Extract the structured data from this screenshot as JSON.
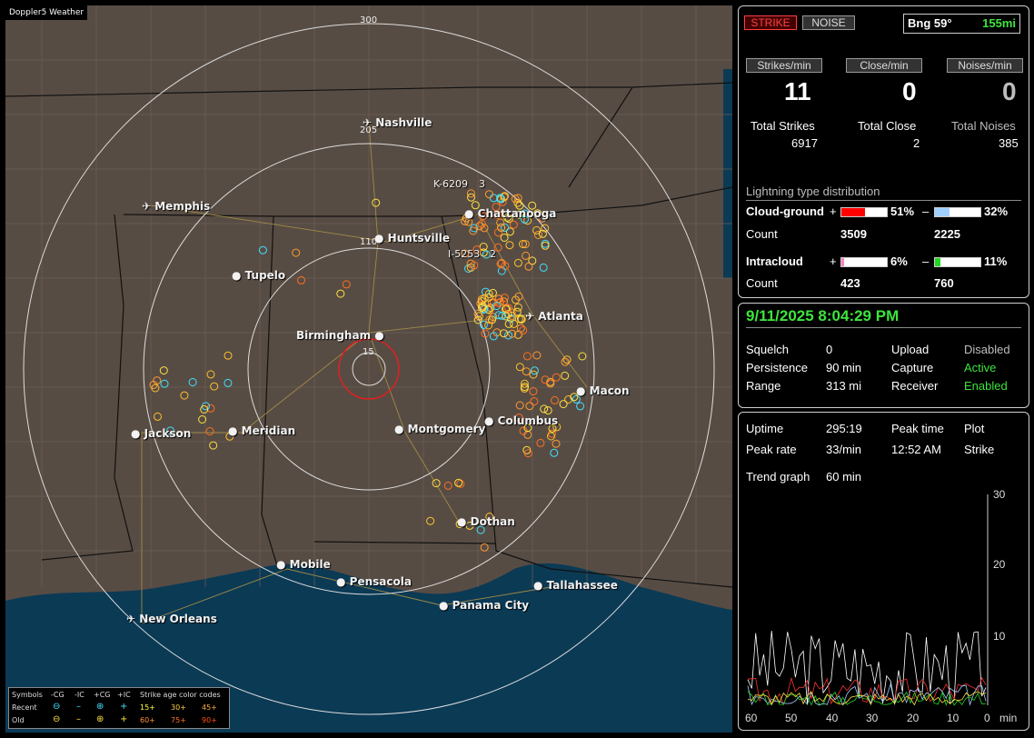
{
  "map": {
    "badge": "Doppler5 Weather",
    "range_labels": [
      "300",
      "205",
      "110",
      "15"
    ],
    "cities": [
      "Nashville",
      "Memphis",
      "Chattanooga",
      "Huntsville",
      "Tupelo",
      "Birmingham",
      "Atlanta",
      "Macon",
      "Jackson",
      "Meridian",
      "Montgomery",
      "Columbus",
      "Dothan",
      "Mobile",
      "Pensacola",
      "Panama City",
      "Tallahassee",
      "New Orleans"
    ],
    "markers": [
      "K-6209",
      "3",
      "I-5253",
      "2"
    ],
    "legend": {
      "symbols_label": "Symbols",
      "cg_minus": "-CG",
      "ic_minus": "-IC",
      "cg_plus": "+CG",
      "ic_plus": "+IC",
      "age_title": "Strike age color codes",
      "recent_label": "Recent",
      "old_label": "Old",
      "ages_recent": [
        "15+",
        "30+",
        "45+"
      ],
      "ages_old": [
        "60+",
        "75+",
        "90+"
      ]
    }
  },
  "strike": {
    "strike_btn": "STRIKE",
    "noise_btn": "NOISE",
    "bearing": "Bng 59°",
    "distance": "155mi",
    "rates": [
      {
        "label": "Strikes/min",
        "value": "11"
      },
      {
        "label": "Close/min",
        "value": "0"
      },
      {
        "label": "Noises/min",
        "value": "0"
      }
    ],
    "totals": [
      {
        "label": "Total Strikes",
        "value": "6917"
      },
      {
        "label": "Total Close",
        "value": "2"
      },
      {
        "label": "Total Noises",
        "value": "385"
      }
    ],
    "dist_title": "Lightning type distribution",
    "cloud_ground": "Cloud-ground",
    "intracloud": "Intracloud",
    "count_label": "Count",
    "cg_plus_pct": "51%",
    "cg_minus_pct": "32%",
    "cg_plus_count": "3509",
    "cg_minus_count": "2225",
    "ic_plus_pct": "6%",
    "ic_minus_pct": "11%",
    "ic_plus_count": "423",
    "ic_minus_count": "760",
    "bar_fill": {
      "cg_plus": 0.51,
      "cg_minus": 0.32,
      "ic_plus": 0.06,
      "ic_minus": 0.11
    },
    "plus": "+",
    "minus": "–"
  },
  "status": {
    "datetime": "9/11/2025 8:04:29 PM",
    "rows": [
      {
        "label": "Squelch",
        "value": "0",
        "label2": "Upload",
        "value2": "Disabled"
      },
      {
        "label": "Persistence",
        "value": "90 min",
        "label2": "Capture",
        "value2": "Active"
      },
      {
        "label": "Range",
        "value": "313 mi",
        "label2": "Receiver",
        "value2": "Enabled"
      }
    ]
  },
  "trend": {
    "uptime_label": "Uptime",
    "uptime": "295:19",
    "peak_time_label": "Peak time",
    "plot_label": "Plot",
    "peak_rate_label": "Peak rate",
    "peak_rate": "33/min",
    "peak_time": "12:52 AM",
    "plot": "Strike",
    "graph_label": "Trend graph",
    "graph_span": "60 min",
    "y_ticks": [
      "30",
      "20",
      "10"
    ],
    "x_ticks": [
      "60",
      "50",
      "40",
      "30",
      "20",
      "10",
      "0"
    ],
    "x_unit": "min",
    "y_max": 30
  },
  "colors": {
    "cg_plus": "#ff0000",
    "cg_minus": "#9fd0ff",
    "ic_plus": "#ff7fbf",
    "ic_minus": "#22d622",
    "green": "#3de43d"
  }
}
